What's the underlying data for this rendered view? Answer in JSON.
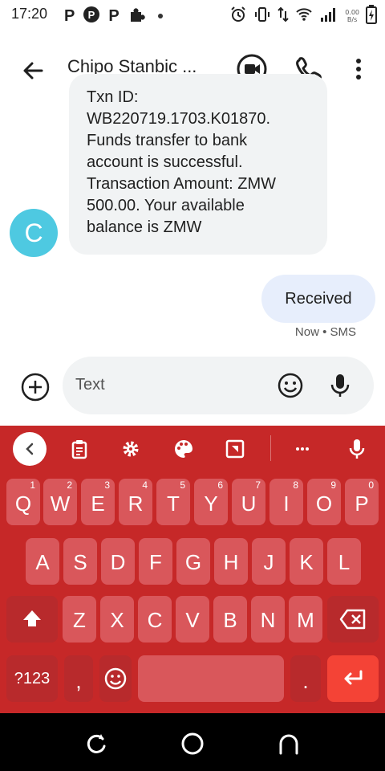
{
  "status_bar": {
    "time": "17:20",
    "left_icons": [
      "P",
      "P",
      "P"
    ],
    "net_speed_value": "0.00",
    "net_speed_unit": "B/s"
  },
  "app_bar": {
    "contact_name": "Chipo Stanbic ...",
    "icons": [
      "back-arrow-icon",
      "video-call-icon",
      "phone-icon",
      "more-vert-icon"
    ]
  },
  "conversation": {
    "incoming": {
      "lines": [
        "Txn ID:",
        "WB220719.1703.K01870.",
        "Funds transfer to bank",
        "account is successful.",
        "Transaction Amount: ZMW",
        "500.00. Your available",
        "balance is ZMW"
      ],
      "avatar_letter": "C",
      "avatar_color": "#4ec9e1"
    },
    "outgoing": {
      "text": "Received",
      "meta": "Now • SMS"
    }
  },
  "compose": {
    "placeholder": "Text"
  },
  "keyboard": {
    "color": "#c62828",
    "row1": [
      {
        "label": "Q",
        "hint": "1"
      },
      {
        "label": "W",
        "hint": "2"
      },
      {
        "label": "E",
        "hint": "3"
      },
      {
        "label": "R",
        "hint": "4"
      },
      {
        "label": "T",
        "hint": "5"
      },
      {
        "label": "Y",
        "hint": "6"
      },
      {
        "label": "U",
        "hint": "7"
      },
      {
        "label": "I",
        "hint": "8"
      },
      {
        "label": "O",
        "hint": "9"
      },
      {
        "label": "P",
        "hint": "0"
      }
    ],
    "row2": [
      "A",
      "S",
      "D",
      "F",
      "G",
      "H",
      "J",
      "K",
      "L"
    ],
    "row3": [
      "Z",
      "X",
      "C",
      "V",
      "B",
      "N",
      "M"
    ],
    "symbols_label": "?123",
    "comma_label": ",",
    "period_label": "."
  }
}
